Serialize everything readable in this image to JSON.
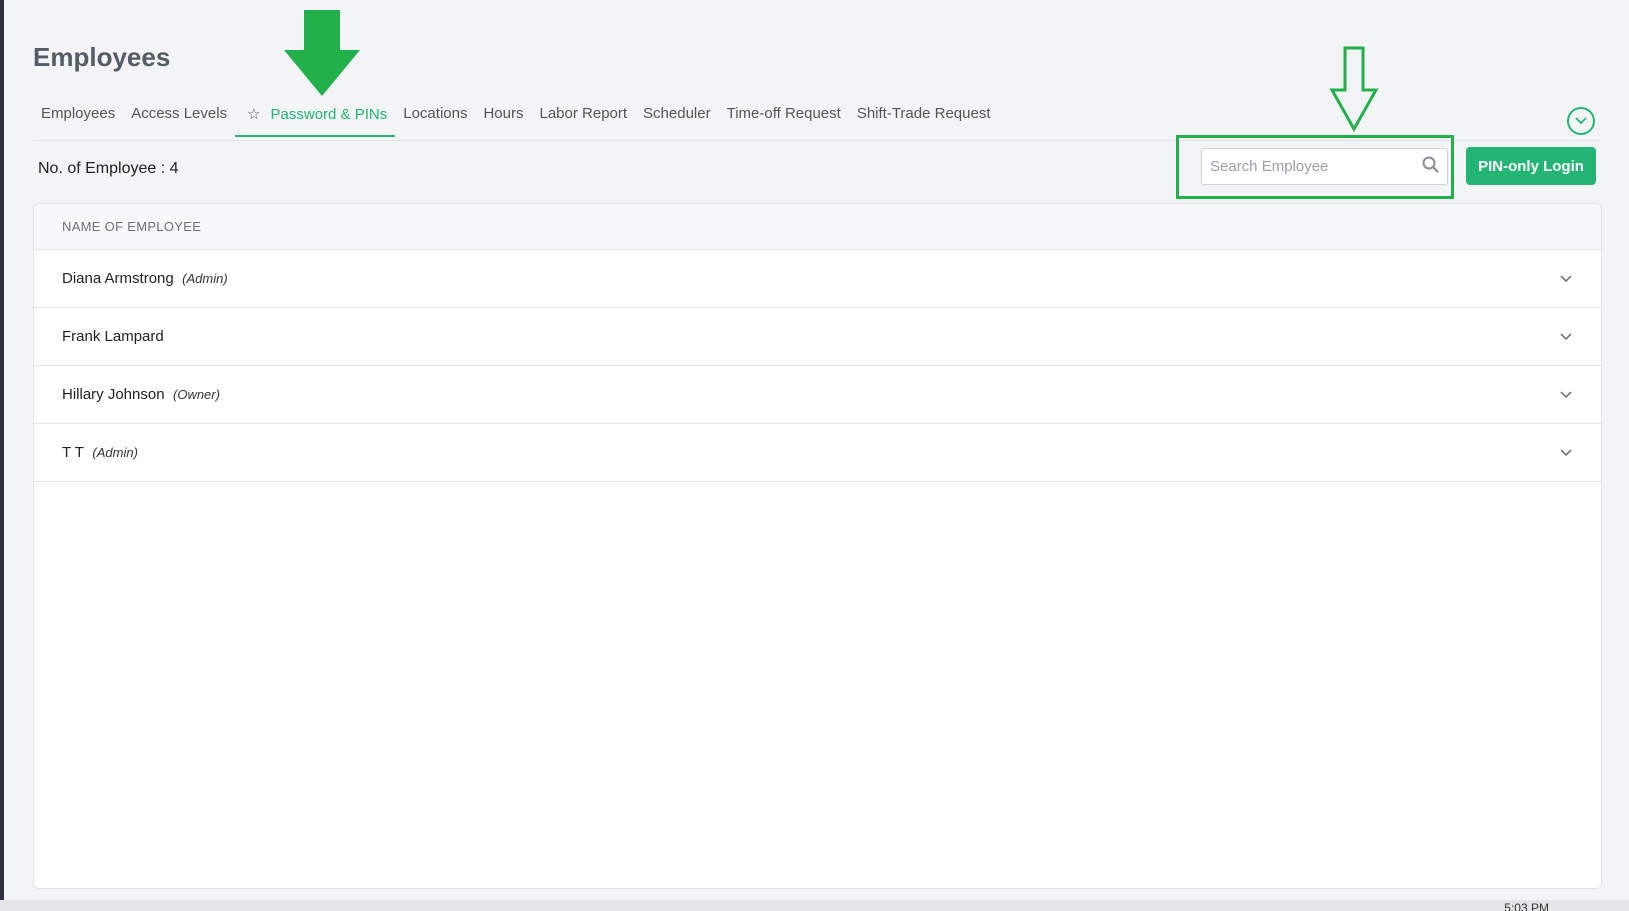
{
  "page": {
    "title": "Employees"
  },
  "tabs": [
    {
      "label": "Employees"
    },
    {
      "label": "Access Levels"
    },
    {
      "label": "Password & PINs"
    },
    {
      "label": "Locations"
    },
    {
      "label": "Hours"
    },
    {
      "label": "Labor Report"
    },
    {
      "label": "Scheduler"
    },
    {
      "label": "Time-off Request"
    },
    {
      "label": "Shift-Trade Request"
    }
  ],
  "active_tab": "Password & PINs",
  "summary": {
    "count_label": "No. of Employee : 4"
  },
  "search": {
    "placeholder": "Search Employee",
    "value": ""
  },
  "actions": {
    "pin_login_label": "PIN-only Login"
  },
  "table": {
    "header": "NAME OF EMPLOYEE",
    "rows": [
      {
        "name": "Diana Armstrong",
        "role": "(Admin)"
      },
      {
        "name": "Frank Lampard",
        "role": ""
      },
      {
        "name": "Hillary Johnson",
        "role": "(Owner)"
      },
      {
        "name": "T T",
        "role": "(Admin)"
      }
    ]
  },
  "taskbar": {
    "clock_fragment": "5:03 PM"
  },
  "colors": {
    "accent": "#22b573",
    "annotation": "#22b04b"
  },
  "icons": [
    "star-icon",
    "search-icon",
    "chevron-down-icon",
    "collapse-toggle-icon",
    "arrow-down-annotation"
  ]
}
